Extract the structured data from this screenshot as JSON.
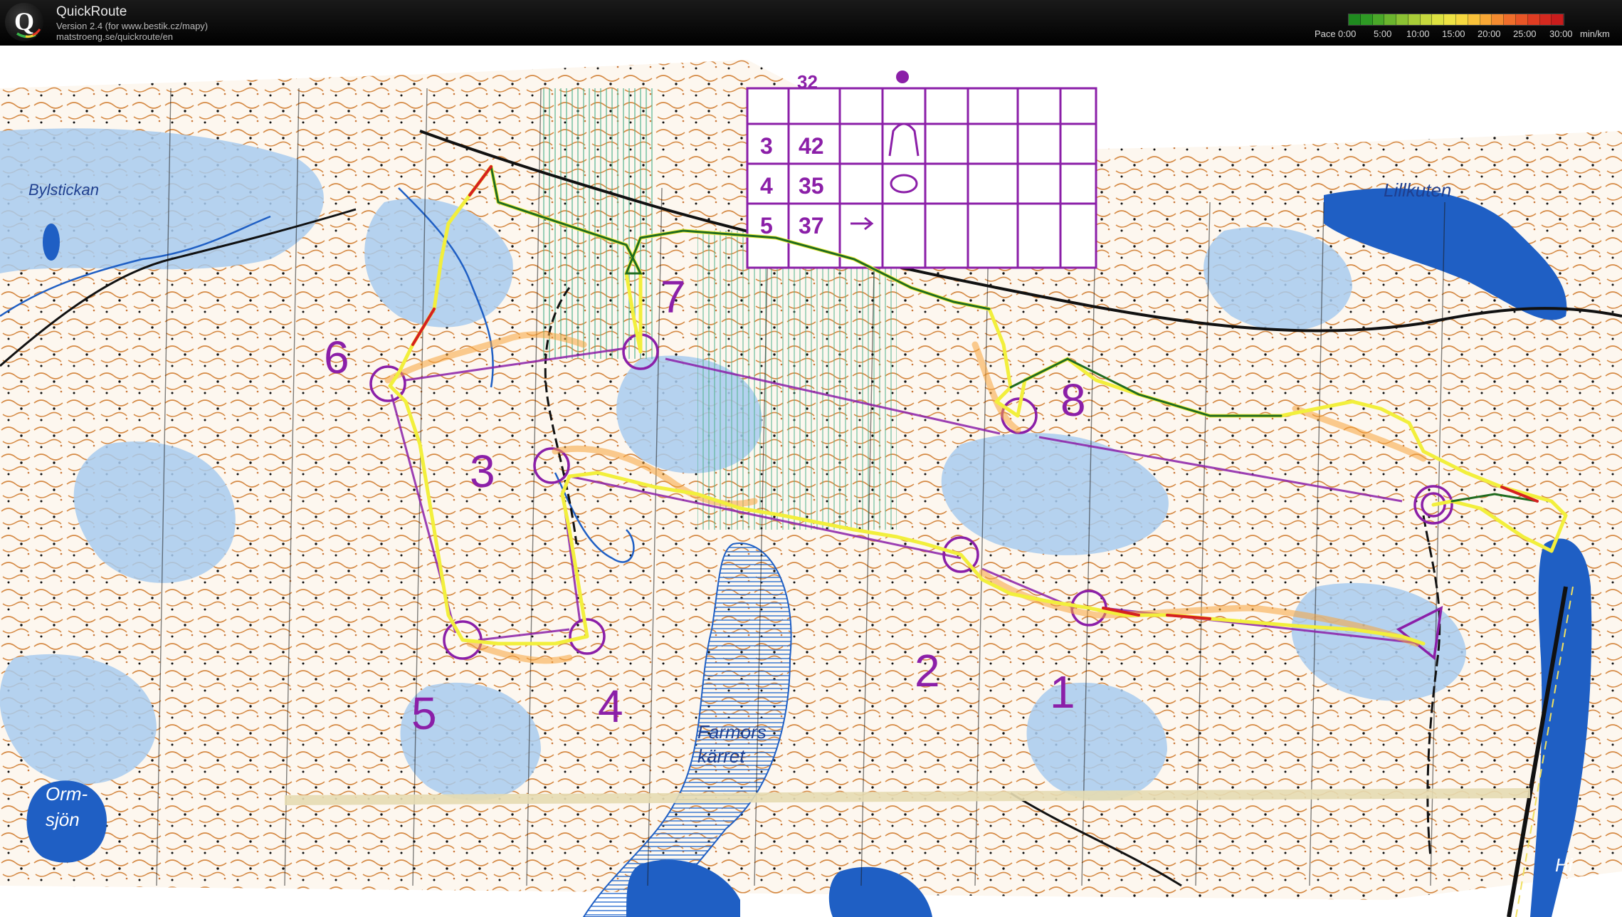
{
  "app": {
    "name": "QuickRoute",
    "version_line": "Version 2.4  (for www.bestik.cz/mapy)",
    "url_line": "matstroeng.se/quickroute/en",
    "logo_letter": "Q"
  },
  "pace_legend": {
    "label": "Pace",
    "ticks": [
      "0:00",
      "5:00",
      "10:00",
      "15:00",
      "20:00",
      "25:00",
      "30:00"
    ],
    "unit": "min/km",
    "scale_colors": [
      "#1f8a1f",
      "#2e9a24",
      "#4aa829",
      "#6bb52e",
      "#8cc233",
      "#a9cd38",
      "#c6d83d",
      "#dde241",
      "#eee344",
      "#f6d83f",
      "#f9c23a",
      "#f8a735",
      "#f48b30",
      "#ef6e2b",
      "#e85526",
      "#df3c22",
      "#d4291f",
      "#c91c1c"
    ]
  },
  "map": {
    "place_names": [
      "Bylstickan",
      "Lillkuten",
      "Farmors",
      "kärret",
      "Orm-",
      "sjön",
      "Hi"
    ],
    "control_numbers": [
      "1",
      "2",
      "3",
      "4",
      "5",
      "6",
      "7",
      "8"
    ],
    "control_card": {
      "rows": [
        {
          "n": "3",
          "code": "42"
        },
        {
          "n": "4",
          "code": "35"
        },
        {
          "n": "5",
          "code": "37"
        }
      ],
      "partial_row_code": "32"
    },
    "colors": {
      "water_blue": "#1f5fc4",
      "marsh_blue": "#7fb4e3",
      "contour_brown": "#c9783a",
      "course_purple": "#8b1fa8",
      "route_yellow": "#f2ef3c",
      "route_green": "#1f6b1f",
      "route_red": "#d62020",
      "road_black": "#111111"
    }
  }
}
